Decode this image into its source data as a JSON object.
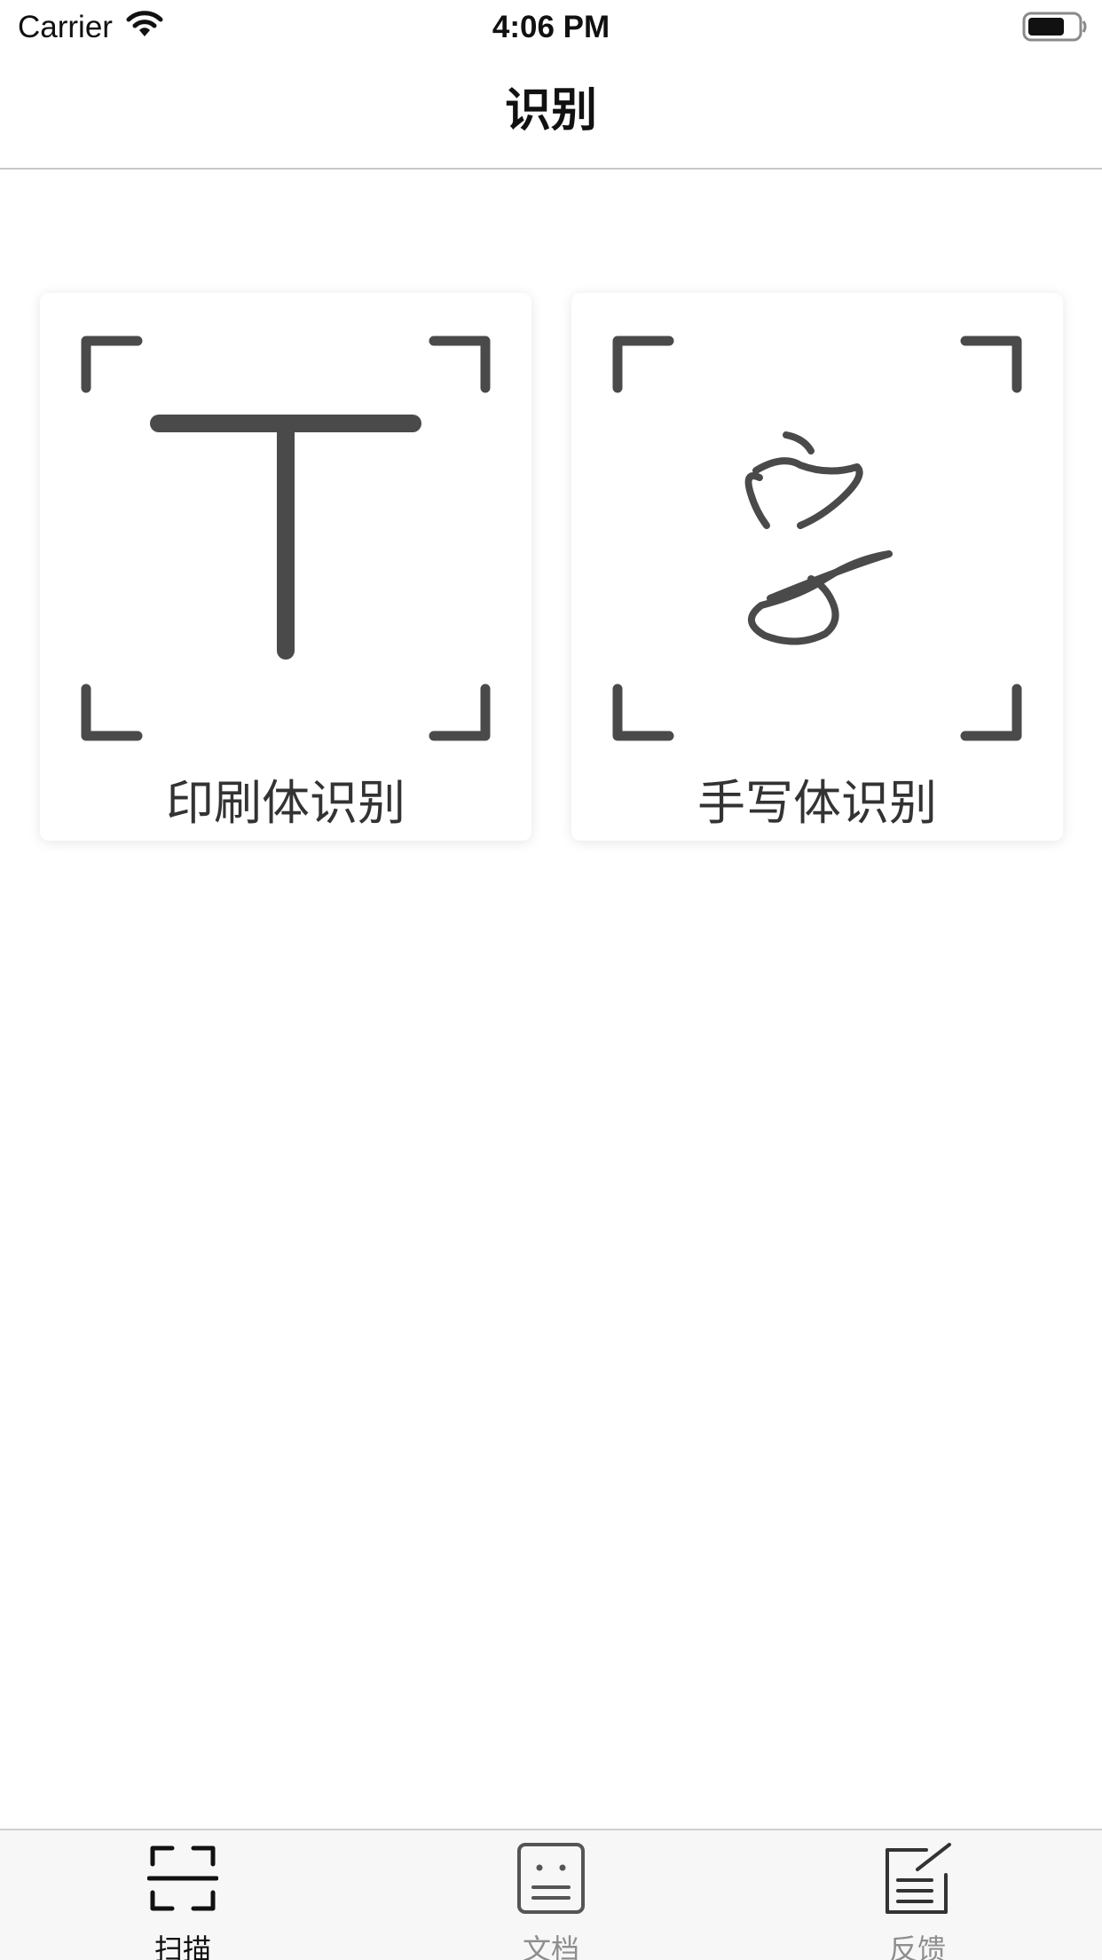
{
  "status_bar": {
    "carrier": "Carrier",
    "time": "4:06 PM"
  },
  "nav": {
    "title": "识别"
  },
  "cards": [
    {
      "label": "印刷体识别",
      "icon": "print-text-icon"
    },
    {
      "label": "手写体识别",
      "icon": "handwriting-icon"
    }
  ],
  "tab_bar": {
    "tabs": [
      {
        "label": "扫描",
        "icon": "scan-icon",
        "selected": true
      },
      {
        "label": "文档",
        "icon": "document-icon",
        "selected": false
      },
      {
        "label": "反馈",
        "icon": "feedback-icon",
        "selected": false
      }
    ]
  },
  "colors": {
    "icon_dark": "#4a4a4a",
    "tab_active": "#111111",
    "tab_inactive": "#8e8e8e",
    "tab_bar_bg": "#f7f7f7"
  }
}
